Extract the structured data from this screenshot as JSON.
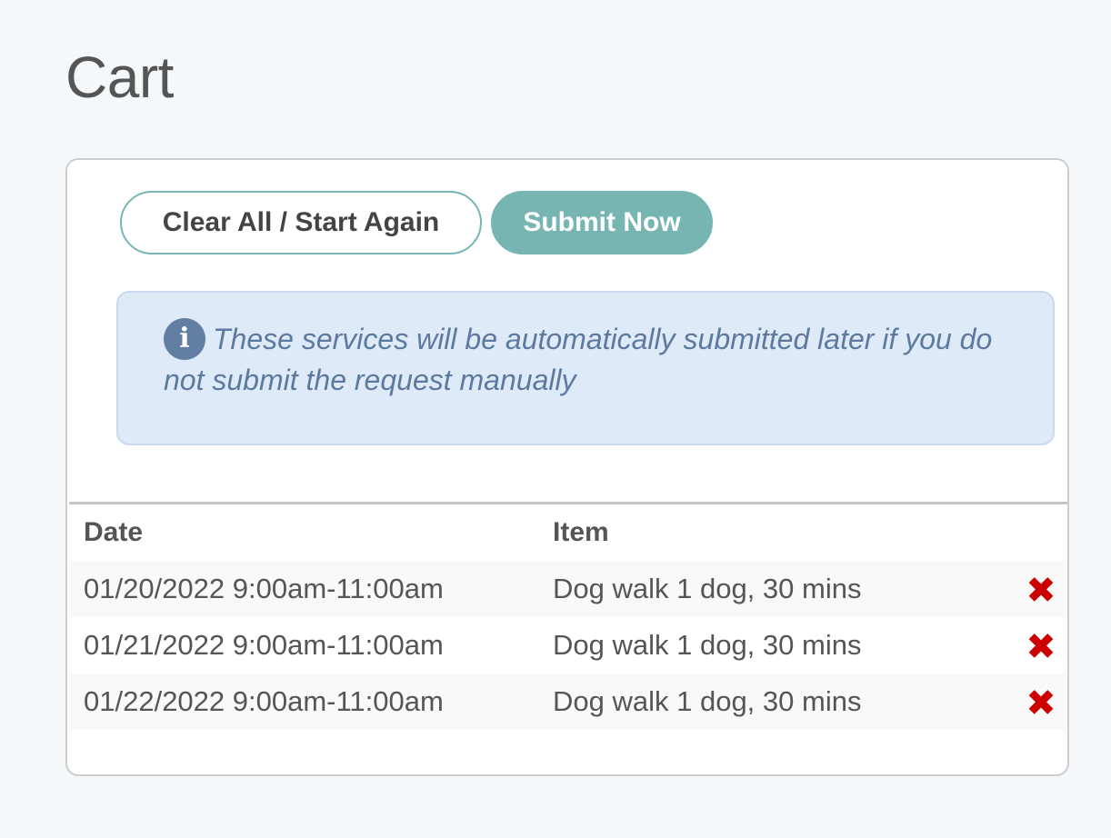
{
  "page": {
    "title": "Cart"
  },
  "actions": {
    "clear_label": "Clear All / Start Again",
    "submit_label": "Submit Now"
  },
  "notice": {
    "icon": "info-icon",
    "icon_glyph": "i",
    "text": "These services will be automatically submitted later if you do not submit the request manually"
  },
  "table": {
    "headers": {
      "date": "Date",
      "item": "Item"
    },
    "rows": [
      {
        "date": "01/20/2022 9:00am-11:00am",
        "item": "Dog walk 1 dog, 30 mins",
        "remove_glyph": "✖"
      },
      {
        "date": "01/21/2022 9:00am-11:00am",
        "item": "Dog walk 1 dog, 30 mins",
        "remove_glyph": "✖"
      },
      {
        "date": "01/22/2022 9:00am-11:00am",
        "item": "Dog walk 1 dog, 30 mins",
        "remove_glyph": "✖"
      }
    ]
  },
  "colors": {
    "accent": "#77b5b3",
    "notice_background": "#dfeaf8",
    "notice_text": "#5c79a0",
    "remove": "#cc0000",
    "page_background": "#f4f8fb"
  }
}
